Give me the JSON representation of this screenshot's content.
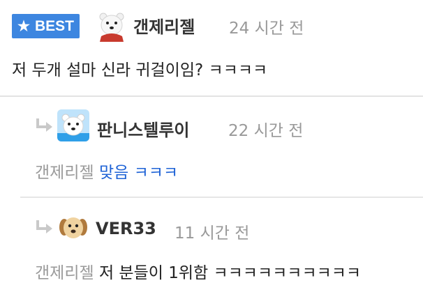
{
  "best_comment": {
    "badge_label": "BEST",
    "author": "갠제리젤",
    "time": "24 시간 전",
    "body": "저 두개 설마 신라 귀걸이임? ㅋㅋㅋㅋ"
  },
  "replies": [
    {
      "author": "판니스텔루이",
      "time": "22 시간 전",
      "mention": "갠제리젤",
      "body_highlight": "맞음",
      "body_rest": "ㅋㅋㅋ"
    },
    {
      "author": "VER33",
      "time": "11 시간 전",
      "mention": "갠제리젤",
      "body": "저 분들이 1위함 ㅋㅋㅋㅋㅋㅋㅋㅋㅋㅋ"
    }
  ],
  "colors": {
    "best_badge": "#3d86e0",
    "link": "#1f63d6",
    "muted": "#999999"
  },
  "icons": [
    "star-icon",
    "reply-arrow-icon"
  ]
}
